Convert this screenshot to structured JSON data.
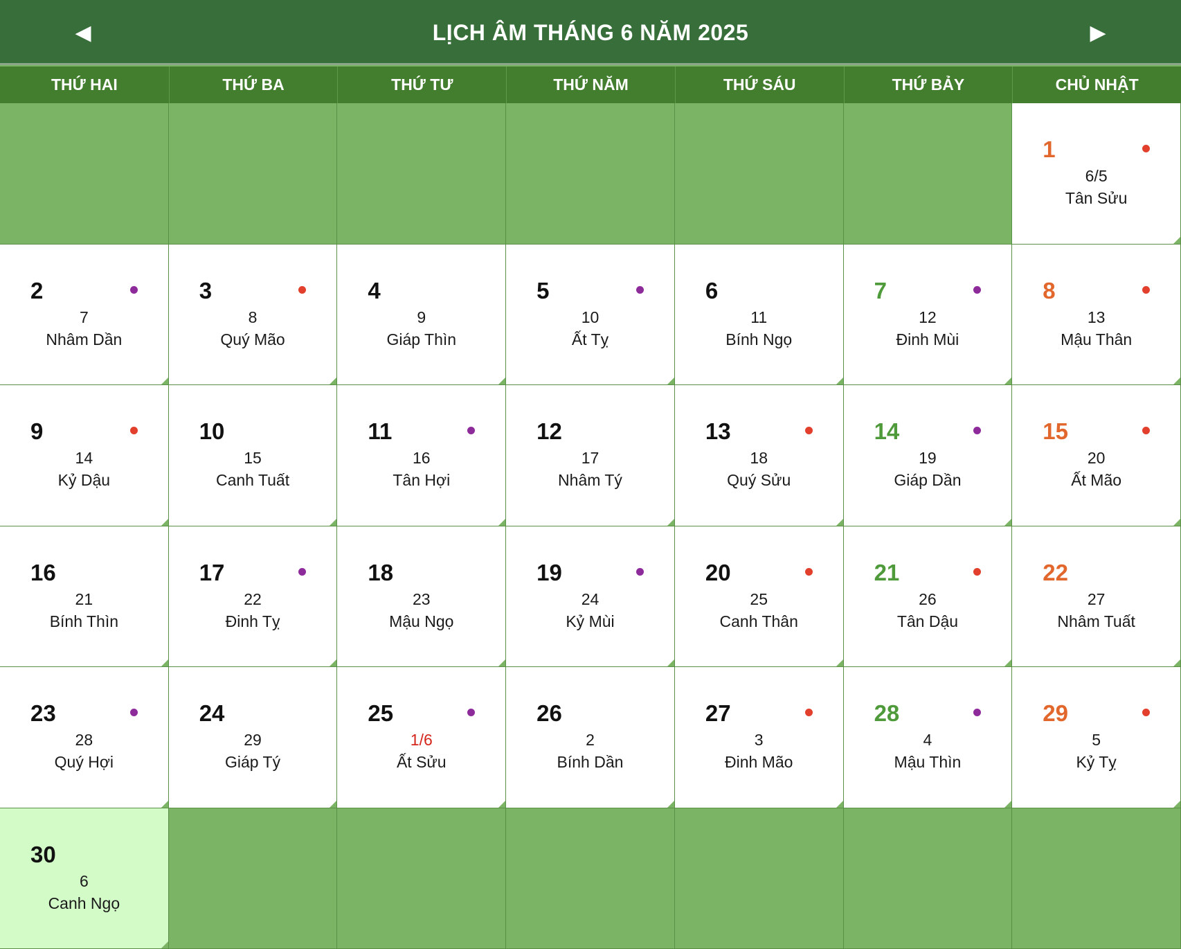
{
  "header": {
    "title": "LỊCH ÂM THÁNG 6 NĂM 2025",
    "prev_icon": "◀",
    "next_icon": "▶"
  },
  "weekdays": [
    "THỨ HAI",
    "THỨ BA",
    "THỨ TƯ",
    "THỨ NĂM",
    "THỨ SÁU",
    "THỨ BẢY",
    "CHỦ NHẬT"
  ],
  "colors": {
    "header_bg": "#376e3a",
    "weekbar_bg": "#437e2e",
    "empty_cell": "#7cb466",
    "today_cell": "#d3fbc8",
    "saturday": "#4f9a3a",
    "sunday": "#e2672c",
    "good_day_dot": "#e2402d",
    "bad_day_dot": "#8e2b9b",
    "new_lunar_month": "#d4261b"
  },
  "days": [
    {
      "solar": "1",
      "lunar": "6/5",
      "canchi": "Tân Sửu",
      "dot": "good"
    },
    {
      "solar": "2",
      "lunar": "7",
      "canchi": "Nhâm Dần",
      "dot": "bad"
    },
    {
      "solar": "3",
      "lunar": "8",
      "canchi": "Quý Mão",
      "dot": "good"
    },
    {
      "solar": "4",
      "lunar": "9",
      "canchi": "Giáp Thìn",
      "dot": ""
    },
    {
      "solar": "5",
      "lunar": "10",
      "canchi": "Ất Tỵ",
      "dot": "bad"
    },
    {
      "solar": "6",
      "lunar": "11",
      "canchi": "Bính Ngọ",
      "dot": ""
    },
    {
      "solar": "7",
      "lunar": "12",
      "canchi": "Đinh Mùi",
      "dot": "bad"
    },
    {
      "solar": "8",
      "lunar": "13",
      "canchi": "Mậu Thân",
      "dot": "good"
    },
    {
      "solar": "9",
      "lunar": "14",
      "canchi": "Kỷ Dậu",
      "dot": "good"
    },
    {
      "solar": "10",
      "lunar": "15",
      "canchi": "Canh Tuất",
      "dot": ""
    },
    {
      "solar": "11",
      "lunar": "16",
      "canchi": "Tân Hợi",
      "dot": "bad"
    },
    {
      "solar": "12",
      "lunar": "17",
      "canchi": "Nhâm Tý",
      "dot": ""
    },
    {
      "solar": "13",
      "lunar": "18",
      "canchi": "Quý Sửu",
      "dot": "good"
    },
    {
      "solar": "14",
      "lunar": "19",
      "canchi": "Giáp Dần",
      "dot": "bad"
    },
    {
      "solar": "15",
      "lunar": "20",
      "canchi": "Ất Mão",
      "dot": "good"
    },
    {
      "solar": "16",
      "lunar": "21",
      "canchi": "Bính Thìn",
      "dot": ""
    },
    {
      "solar": "17",
      "lunar": "22",
      "canchi": "Đinh Tỵ",
      "dot": "bad"
    },
    {
      "solar": "18",
      "lunar": "23",
      "canchi": "Mậu Ngọ",
      "dot": ""
    },
    {
      "solar": "19",
      "lunar": "24",
      "canchi": "Kỷ Mùi",
      "dot": "bad"
    },
    {
      "solar": "20",
      "lunar": "25",
      "canchi": "Canh Thân",
      "dot": "good"
    },
    {
      "solar": "21",
      "lunar": "26",
      "canchi": "Tân Dậu",
      "dot": "good"
    },
    {
      "solar": "22",
      "lunar": "27",
      "canchi": "Nhâm Tuất",
      "dot": ""
    },
    {
      "solar": "23",
      "lunar": "28",
      "canchi": "Quý Hợi",
      "dot": "bad"
    },
    {
      "solar": "24",
      "lunar": "29",
      "canchi": "Giáp Tý",
      "dot": ""
    },
    {
      "solar": "25",
      "lunar": "1/6",
      "canchi": "Ất Sửu",
      "dot": "bad",
      "new_month": true
    },
    {
      "solar": "26",
      "lunar": "2",
      "canchi": "Bính Dần",
      "dot": ""
    },
    {
      "solar": "27",
      "lunar": "3",
      "canchi": "Đinh Mão",
      "dot": "good"
    },
    {
      "solar": "28",
      "lunar": "4",
      "canchi": "Mậu Thìn",
      "dot": "bad"
    },
    {
      "solar": "29",
      "lunar": "5",
      "canchi": "Kỷ Tỵ",
      "dot": "good"
    },
    {
      "solar": "30",
      "lunar": "6",
      "canchi": "Canh Ngọ",
      "dot": "",
      "today": true
    }
  ]
}
